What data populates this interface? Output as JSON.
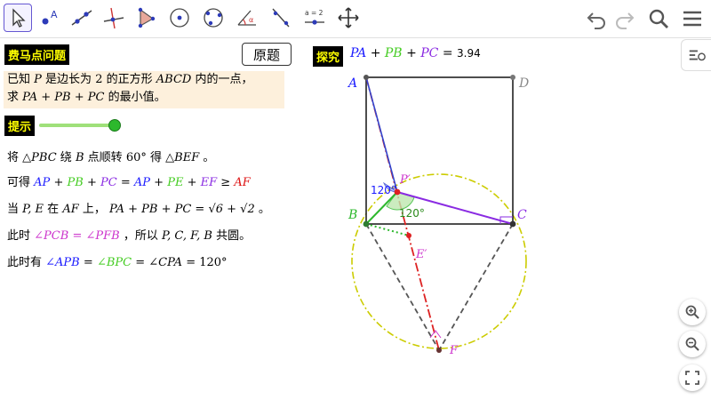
{
  "toolbar": {
    "tools": [
      {
        "name": "move-tool",
        "active": true
      },
      {
        "name": "point-tool",
        "label": "A"
      },
      {
        "name": "line-tool"
      },
      {
        "name": "perpendicular-tool"
      },
      {
        "name": "polygon-tool"
      },
      {
        "name": "circle-tool"
      },
      {
        "name": "conic-tool"
      },
      {
        "name": "angle-tool",
        "label": "α"
      },
      {
        "name": "reflect-tool"
      },
      {
        "name": "slider-tool",
        "label": "a = 2"
      },
      {
        "name": "move-view-tool"
      }
    ]
  },
  "left": {
    "title_tag": "费马点问题",
    "original_button": "原题",
    "problem_line1_pre": "已知",
    "problem_P": "P",
    "problem_line1_mid": "是边长为",
    "problem_two": "2",
    "problem_line1_mid2": "的正方形",
    "problem_ABCD": "ABCD",
    "problem_line1_post": "内的一点，",
    "problem_line2_pre": "求",
    "problem_expr": "PA + PB + PC",
    "problem_line2_post": "的最小值。",
    "hint_tag": "提示",
    "hint_slider_value": 1,
    "step1_a": "将",
    "step1_tri1": "△PBC",
    "step1_b": "绕",
    "step1_B": "B",
    "step1_c": "点顺转",
    "step1_deg": "60°",
    "step1_d": "得",
    "step1_tri2": "△BEF",
    "step1_e": "。",
    "step2_pre": "可得",
    "step2_AP": "AP",
    "step2_PB": "PB",
    "step2_PC": "PC",
    "step2_AP2": "AP",
    "step2_PE": "PE",
    "step2_EF": "EF",
    "step2_AF": "AF",
    "step2_plus": "+",
    "step2_eq": "=",
    "step2_ge": "≥",
    "step3_a": "当",
    "step3_PE": "P, E",
    "step3_b": "在",
    "step3_AF": "AF",
    "step3_c": "上，",
    "step3_expr": "PA + PB + PC = √6 + √2",
    "step3_d": "。",
    "step4_a": "此时",
    "step4_ang1": "∠PCB",
    "step4_eq": "=",
    "step4_ang2": "∠PFB",
    "step4_b": "，所以",
    "step4_pts": "P, C, F, B",
    "step4_c": "共圆。",
    "step5_a": "此时有",
    "step5_ang1": "∠APB",
    "step5_eq1": "=",
    "step5_ang2": "∠BPC",
    "step5_eq2": "=",
    "step5_ang3": "∠CPA",
    "step5_val": "= 120°"
  },
  "right": {
    "explore_tag": "探究",
    "sum_PA": "PA",
    "sum_PB": "PB",
    "sum_PC": "PC",
    "sum_plus": "+",
    "sum_eq": "=",
    "sum_value": "3.94",
    "labels": {
      "A": "A",
      "B": "B",
      "C": "C",
      "D": "D",
      "P": "P′",
      "E": "E′",
      "F": "F"
    },
    "angle1": "120°",
    "angle2": "120°"
  },
  "colors": {
    "accent": "#6557d2",
    "tag_bg": "#000000",
    "tag_fg": "#ffff00",
    "problem_bg": "#fdf0dc",
    "blue": "#1a1aff",
    "green": "#44cc22",
    "purple": "#8a2be2",
    "red": "#dd1111",
    "circle": "#cccc00"
  },
  "icons": [
    "undo-icon",
    "redo-icon",
    "search-icon",
    "menu-icon",
    "zoom-in-icon",
    "zoom-out-icon",
    "fullscreen-icon",
    "algebra-view-icon"
  ]
}
